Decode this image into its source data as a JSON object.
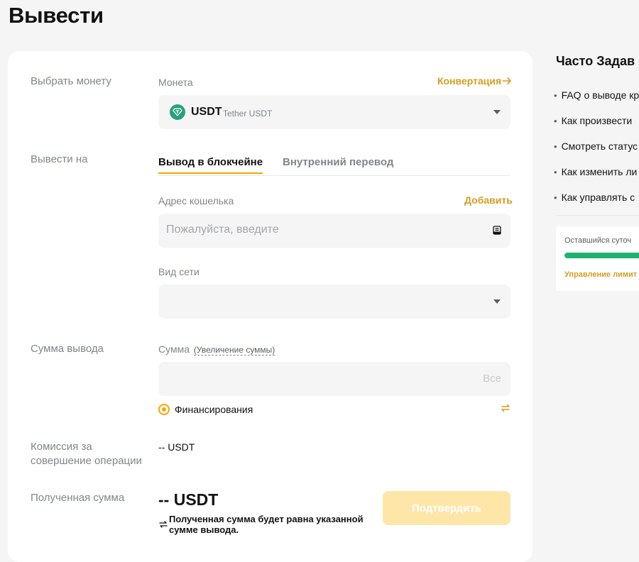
{
  "page": {
    "title": "Вывести"
  },
  "coin_row": {
    "label": "Выбрать монету",
    "field_label": "Монета",
    "convert_link": "Конвертация",
    "selected_symbol": "USDT",
    "selected_name": "Tether USDT"
  },
  "withdraw_to": {
    "label": "Вывести на",
    "tabs": [
      {
        "label": "Вывод в блокчейне",
        "active": true
      },
      {
        "label": "Внутренний перевод",
        "active": false
      }
    ],
    "wallet_label": "Адрес кошелька",
    "add_link": "Добавить",
    "wallet_placeholder": "Пожалуйста, введите",
    "network_label": "Вид сети",
    "network_value": ""
  },
  "amount": {
    "label": "Сумма вывода",
    "field_label": "Сумма",
    "increase_link": "(Увеличение суммы)",
    "all_button": "Все",
    "radio_label": "Финансирования"
  },
  "fee": {
    "label_line1": "Комиссия за",
    "label_line2": "совершение операции",
    "value": "-- USDT"
  },
  "received": {
    "label": "Полученная сумма",
    "value": "-- USDT",
    "note_line1": "Полученная сумма будет равна указанной",
    "note_line2": "сумме вывода.",
    "confirm_button": "Подтвердить"
  },
  "faq": {
    "title": "Часто Задав",
    "items": [
      "FAQ о выводе кр",
      "Как произвести",
      "Смотреть статус",
      "Как изменить ли",
      "Как управлять с"
    ]
  },
  "limit": {
    "label": "Оставшийся суточ",
    "progress": 1.0,
    "manage_link": "Управление лимит"
  },
  "colors": {
    "accent": "#f7a600",
    "accent_text": "#d39e21",
    "tether": "#26a17b",
    "progress": "#20b26c"
  },
  "icons": {
    "convert": "arrow-right-icon",
    "address_book": "address-book-icon",
    "swap": "swap-icon",
    "note": "exchange-arrows-icon"
  }
}
